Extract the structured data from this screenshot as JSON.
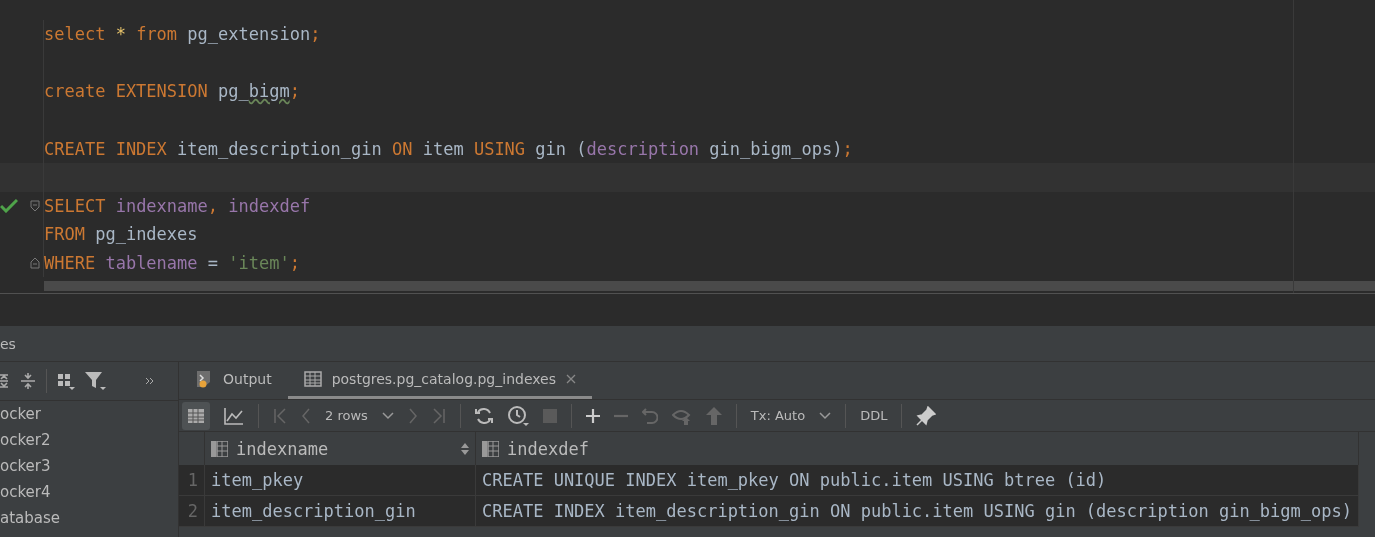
{
  "editor": {
    "lines": [
      {
        "tokens": [
          {
            "kind": "kw",
            "text": "select"
          },
          {
            "kind": "op",
            "text": " * "
          },
          {
            "kind": "kw",
            "text": "from"
          },
          {
            "kind": "id",
            "text": " pg_extension"
          },
          {
            "kind": "kw",
            "text": ";"
          }
        ]
      },
      {
        "kind": "blank"
      },
      {
        "tokens": [
          {
            "kind": "kw",
            "text": "create EXTENSION"
          },
          {
            "kind": "id",
            "text": " pg_"
          },
          {
            "kind": "typo",
            "text": "bigm"
          },
          {
            "kind": "kw",
            "text": ";"
          }
        ]
      },
      {
        "kind": "blank"
      },
      {
        "tokens": [
          {
            "kind": "kw",
            "text": "CREATE INDEX"
          },
          {
            "kind": "id",
            "text": " item_description_gin "
          },
          {
            "kind": "kw",
            "text": "ON"
          },
          {
            "kind": "id",
            "text": " item "
          },
          {
            "kind": "kw",
            "text": "USING"
          },
          {
            "kind": "id",
            "text": " gin ("
          },
          {
            "kind": "col",
            "text": "description"
          },
          {
            "kind": "id",
            "text": " gin_bigm_ops)"
          },
          {
            "kind": "kw",
            "text": ";"
          }
        ]
      },
      {
        "kind": "blank",
        "current": true
      },
      {
        "tokens": [
          {
            "kind": "kw",
            "text": "SELECT"
          },
          {
            "kind": "col",
            "text": " indexname"
          },
          {
            "kind": "kw",
            "text": ","
          },
          {
            "kind": "col",
            "text": " indexdef"
          }
        ],
        "executed": true,
        "fold_open": true
      },
      {
        "tokens": [
          {
            "kind": "kw",
            "text": "FROM"
          },
          {
            "kind": "id",
            "text": " pg_indexes"
          }
        ]
      },
      {
        "tokens": [
          {
            "kind": "kw",
            "text": "WHERE"
          },
          {
            "kind": "col",
            "text": " tablename"
          },
          {
            "kind": "id",
            "text": " = "
          },
          {
            "kind": "str",
            "text": "'item'"
          },
          {
            "kind": "kw",
            "text": ";"
          }
        ],
        "fold_close": true
      }
    ]
  },
  "panel_title": "es",
  "sidebar": {
    "items": [
      "ocker",
      "ocker2",
      "ocker3",
      "ocker4",
      "atabase"
    ]
  },
  "tabs": [
    {
      "label": "Output",
      "kind": "output",
      "selected": false
    },
    {
      "label": "postgres.pg_catalog.pg_indexes",
      "kind": "table",
      "selected": true,
      "closable": true
    }
  ],
  "toolbar": {
    "rows": "2 rows",
    "tx": "Tx: Auto",
    "ddl": "DDL"
  },
  "table": {
    "columns": [
      {
        "label": "indexname",
        "sortable": true
      },
      {
        "label": "indexdef",
        "sortable": false
      }
    ],
    "rows": [
      {
        "num": "1",
        "cells": [
          "item_pkey",
          "CREATE UNIQUE INDEX item_pkey ON public.item USING btree (id)"
        ]
      },
      {
        "num": "2",
        "cells": [
          "item_description_gin",
          "CREATE INDEX item_description_gin ON public.item USING gin (description gin_bigm_ops)"
        ]
      }
    ]
  }
}
